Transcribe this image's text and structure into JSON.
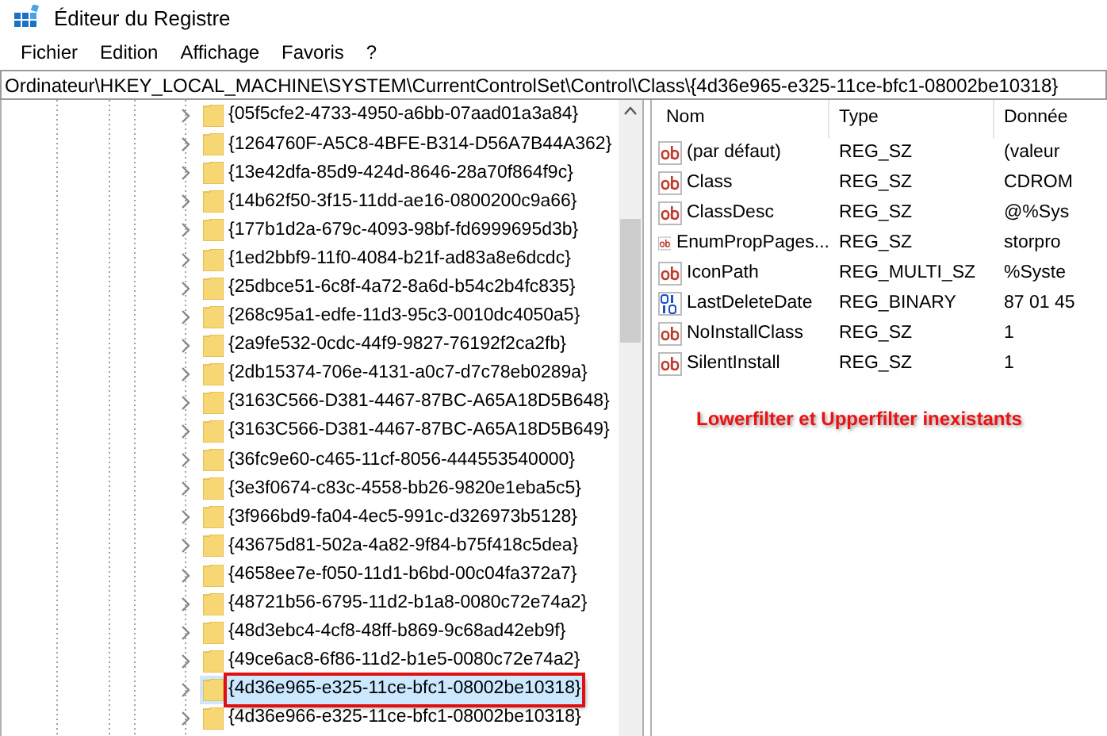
{
  "window": {
    "title": "Éditeur du Registre"
  },
  "menu": [
    "Fichier",
    "Edition",
    "Affichage",
    "Favoris",
    "?"
  ],
  "address": "Ordinateur\\HKEY_LOCAL_MACHINE\\SYSTEM\\CurrentControlSet\\Control\\Class\\{4d36e965-e325-11ce-bfc1-08002be10318}",
  "tree": [
    {
      "label": "{05f5cfe2-4733-4950-a6bb-07aad01a3a84}",
      "selected": false,
      "annotated": false
    },
    {
      "label": "{1264760F-A5C8-4BFE-B314-D56A7B44A362}",
      "selected": false,
      "annotated": false
    },
    {
      "label": "{13e42dfa-85d9-424d-8646-28a70f864f9c}",
      "selected": false,
      "annotated": false
    },
    {
      "label": "{14b62f50-3f15-11dd-ae16-0800200c9a66}",
      "selected": false,
      "annotated": false
    },
    {
      "label": "{177b1d2a-679c-4093-98bf-fd6999695d3b}",
      "selected": false,
      "annotated": false
    },
    {
      "label": "{1ed2bbf9-11f0-4084-b21f-ad83a8e6dcdc}",
      "selected": false,
      "annotated": false
    },
    {
      "label": "{25dbce51-6c8f-4a72-8a6d-b54c2b4fc835}",
      "selected": false,
      "annotated": false
    },
    {
      "label": "{268c95a1-edfe-11d3-95c3-0010dc4050a5}",
      "selected": false,
      "annotated": false
    },
    {
      "label": "{2a9fe532-0cdc-44f9-9827-76192f2ca2fb}",
      "selected": false,
      "annotated": false
    },
    {
      "label": "{2db15374-706e-4131-a0c7-d7c78eb0289a}",
      "selected": false,
      "annotated": false
    },
    {
      "label": "{3163C566-D381-4467-87BC-A65A18D5B648}",
      "selected": false,
      "annotated": false
    },
    {
      "label": "{3163C566-D381-4467-87BC-A65A18D5B649}",
      "selected": false,
      "annotated": false
    },
    {
      "label": "{36fc9e60-c465-11cf-8056-444553540000}",
      "selected": false,
      "annotated": false
    },
    {
      "label": "{3e3f0674-c83c-4558-bb26-9820e1eba5c5}",
      "selected": false,
      "annotated": false
    },
    {
      "label": "{3f966bd9-fa04-4ec5-991c-d326973b5128}",
      "selected": false,
      "annotated": false
    },
    {
      "label": "{43675d81-502a-4a82-9f84-b75f418c5dea}",
      "selected": false,
      "annotated": false
    },
    {
      "label": "{4658ee7e-f050-11d1-b6bd-00c04fa372a7}",
      "selected": false,
      "annotated": false
    },
    {
      "label": "{48721b56-6795-11d2-b1a8-0080c72e74a2}",
      "selected": false,
      "annotated": false
    },
    {
      "label": "{48d3ebc4-4cf8-48ff-b869-9c68ad42eb9f}",
      "selected": false,
      "annotated": false
    },
    {
      "label": "{49ce6ac8-6f86-11d2-b1e5-0080c72e74a2}",
      "selected": false,
      "annotated": false
    },
    {
      "label": "{4d36e965-e325-11ce-bfc1-08002be10318}",
      "selected": true,
      "annotated": true
    },
    {
      "label": "{4d36e966-e325-11ce-bfc1-08002be10318}",
      "selected": false,
      "annotated": false
    }
  ],
  "values": {
    "columns": [
      "Nom",
      "Type",
      "Donnée"
    ],
    "rows": [
      {
        "kind": "string",
        "name": "(par défaut)",
        "type": "REG_SZ",
        "data": "(valeur"
      },
      {
        "kind": "string",
        "name": "Class",
        "type": "REG_SZ",
        "data": "CDROM"
      },
      {
        "kind": "string",
        "name": "ClassDesc",
        "type": "REG_SZ",
        "data": "@%Sys"
      },
      {
        "kind": "string",
        "name": "EnumPropPages...",
        "type": "REG_SZ",
        "data": "storpro"
      },
      {
        "kind": "string",
        "name": "IconPath",
        "type": "REG_MULTI_SZ",
        "data": "%Syste"
      },
      {
        "kind": "binary",
        "name": "LastDeleteDate",
        "type": "REG_BINARY",
        "data": "87 01 45"
      },
      {
        "kind": "string",
        "name": "NoInstallClass",
        "type": "REG_SZ",
        "data": "1"
      },
      {
        "kind": "string",
        "name": "SilentInstall",
        "type": "REG_SZ",
        "data": "1"
      }
    ]
  },
  "annotation": "Lowerfilter et Upperfilter inexistants"
}
